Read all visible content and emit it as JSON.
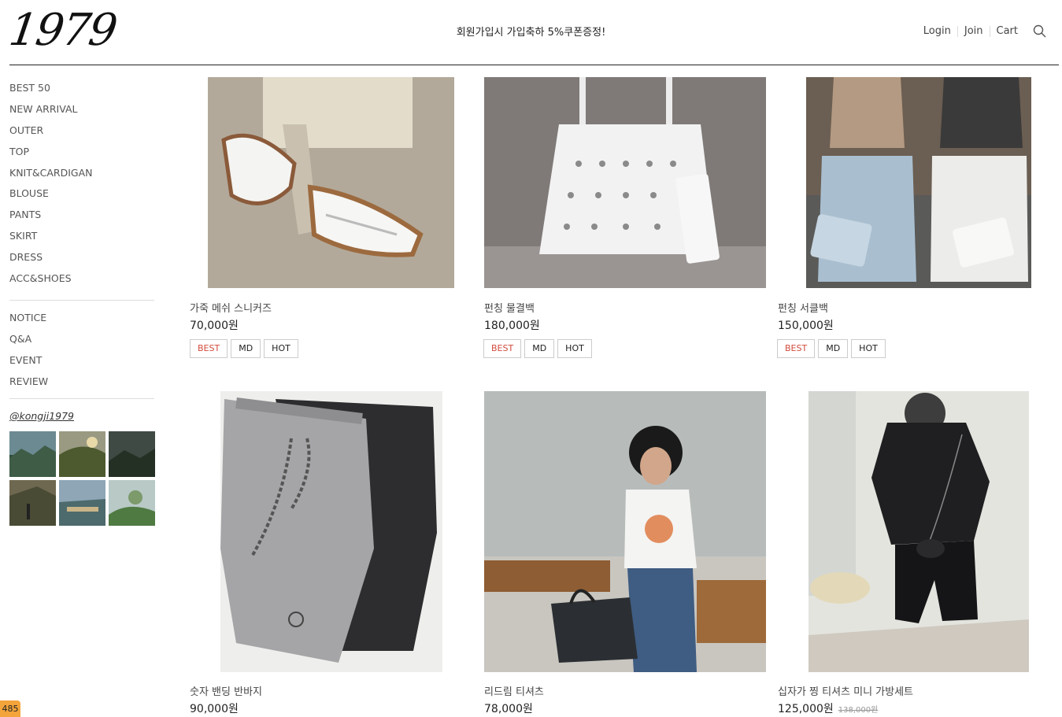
{
  "header": {
    "logo": "1979",
    "promo": "회원가입시 가입축하 5%쿠폰증정!",
    "nav": [
      "Login",
      "Join",
      "Cart"
    ],
    "search_icon": "search-icon"
  },
  "sidebar": {
    "categories": [
      "BEST 50",
      "NEW ARRIVAL",
      "OUTER",
      "TOP",
      "KNIT&CARDIGAN",
      "BLOUSE",
      "PANTS",
      "SKIRT",
      "DRESS",
      "ACC&SHOES"
    ],
    "board": [
      "NOTICE",
      "Q&A",
      "EVENT",
      "REVIEW"
    ],
    "instagram": "@kongji1979"
  },
  "products": [
    {
      "name": "가죽 메쉬 스니커즈",
      "price": "70,000원",
      "badges": [
        "BEST",
        "MD",
        "HOT"
      ]
    },
    {
      "name": "펀칭 물결백",
      "price": "180,000원",
      "badges": [
        "BEST",
        "MD",
        "HOT"
      ]
    },
    {
      "name": "펀칭 서클백",
      "price": "150,000원",
      "badges": [
        "BEST",
        "MD",
        "HOT"
      ]
    },
    {
      "name": "숫자 밴딩 반바지",
      "price": "90,000원",
      "badges": []
    },
    {
      "name": "리드림 티셔츠",
      "price": "78,000원",
      "badges": []
    },
    {
      "name": "십자가 찡 티셔츠 미니 가방세트",
      "price": "125,000원",
      "old_price": "138,000원",
      "badges": []
    }
  ],
  "counter": "485",
  "colors": {
    "best": "#d24b3c",
    "counter": "#f3a43b"
  }
}
